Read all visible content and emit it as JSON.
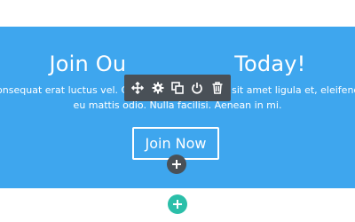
{
  "hero": {
    "heading_left": "Join Ou",
    "heading_right": "Today!",
    "body_line1": "consequat erat luctus vel. Cras nunc est, laoreet sit amet ligula et, eleifend com",
    "body_line2": "eu mattis odio. Nulla facilisi. Aenean in mi.",
    "cta_label": "Join Now",
    "background_color": "#3ea6ee"
  },
  "toolbar": {
    "background_color": "#495057",
    "tools": [
      "move-icon",
      "settings-icon",
      "duplicate-icon",
      "power-icon",
      "trash-icon"
    ]
  },
  "add_buttons": {
    "module_color": "#495057",
    "section_color": "#2bbfa9",
    "icon": "plus-icon"
  }
}
